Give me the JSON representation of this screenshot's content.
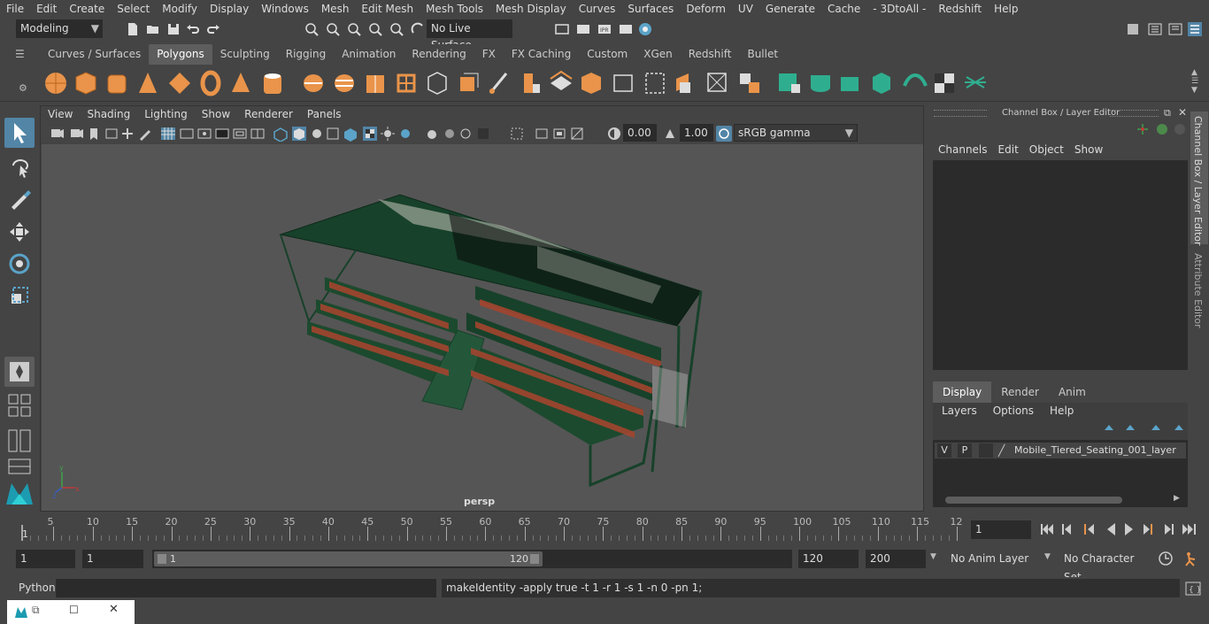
{
  "menubar": [
    "File",
    "Edit",
    "Create",
    "Select",
    "Modify",
    "Display",
    "Windows",
    "Mesh",
    "Edit Mesh",
    "Mesh Tools",
    "Mesh Display",
    "Curves",
    "Surfaces",
    "Deform",
    "UV",
    "Generate",
    "Cache",
    "- 3DtoAll -",
    "Redshift",
    "Help"
  ],
  "status": {
    "mode": "Modeling",
    "live_surface": "No Live Surface"
  },
  "shelf_tabs": [
    "Curves / Surfaces",
    "Polygons",
    "Sculpting",
    "Rigging",
    "Animation",
    "Rendering",
    "FX",
    "FX Caching",
    "Custom",
    "XGen",
    "Redshift",
    "Bullet"
  ],
  "shelf_active": "Polygons",
  "viewport": {
    "menu": [
      "View",
      "Shading",
      "Lighting",
      "Show",
      "Renderer",
      "Panels"
    ],
    "exposure": "0.00",
    "gamma": "1.00",
    "colorspace": "sRGB gamma",
    "camera_label": "persp"
  },
  "channel_box": {
    "title": "Channel Box / Layer Editor",
    "menu": [
      "Channels",
      "Edit",
      "Object",
      "Show"
    ]
  },
  "layer_editor": {
    "tabs": [
      "Display",
      "Render",
      "Anim"
    ],
    "active_tab": "Display",
    "menu": [
      "Layers",
      "Options",
      "Help"
    ],
    "layer": {
      "v": "V",
      "p": "P",
      "name": "Mobile_Tiered_Seating_001_layer"
    }
  },
  "side_tabs": [
    "Channel Box / Layer Editor",
    "Attribute Editor"
  ],
  "timeline": {
    "ticks": [
      "5",
      "10",
      "15",
      "20",
      "25",
      "30",
      "35",
      "40",
      "45",
      "50",
      "55",
      "60",
      "65",
      "70",
      "75",
      "80",
      "85",
      "90",
      "95",
      "100",
      "105",
      "110",
      "115",
      "12"
    ],
    "start_label": "1",
    "current_frame": "1"
  },
  "range": {
    "start": "1",
    "playback_start": "1",
    "slider_start": "1",
    "slider_end": "120",
    "playback_end": "120",
    "end": "200",
    "anim_layer": "No Anim Layer",
    "char_set": "No Character Set"
  },
  "cmd": {
    "lang": "Python",
    "feedback": "makeIdentity -apply true -t 1 -r 1 -s 1 -n 0 -pn 1;"
  },
  "colors": {
    "accent": "#5285a6",
    "model": "#17412a"
  }
}
